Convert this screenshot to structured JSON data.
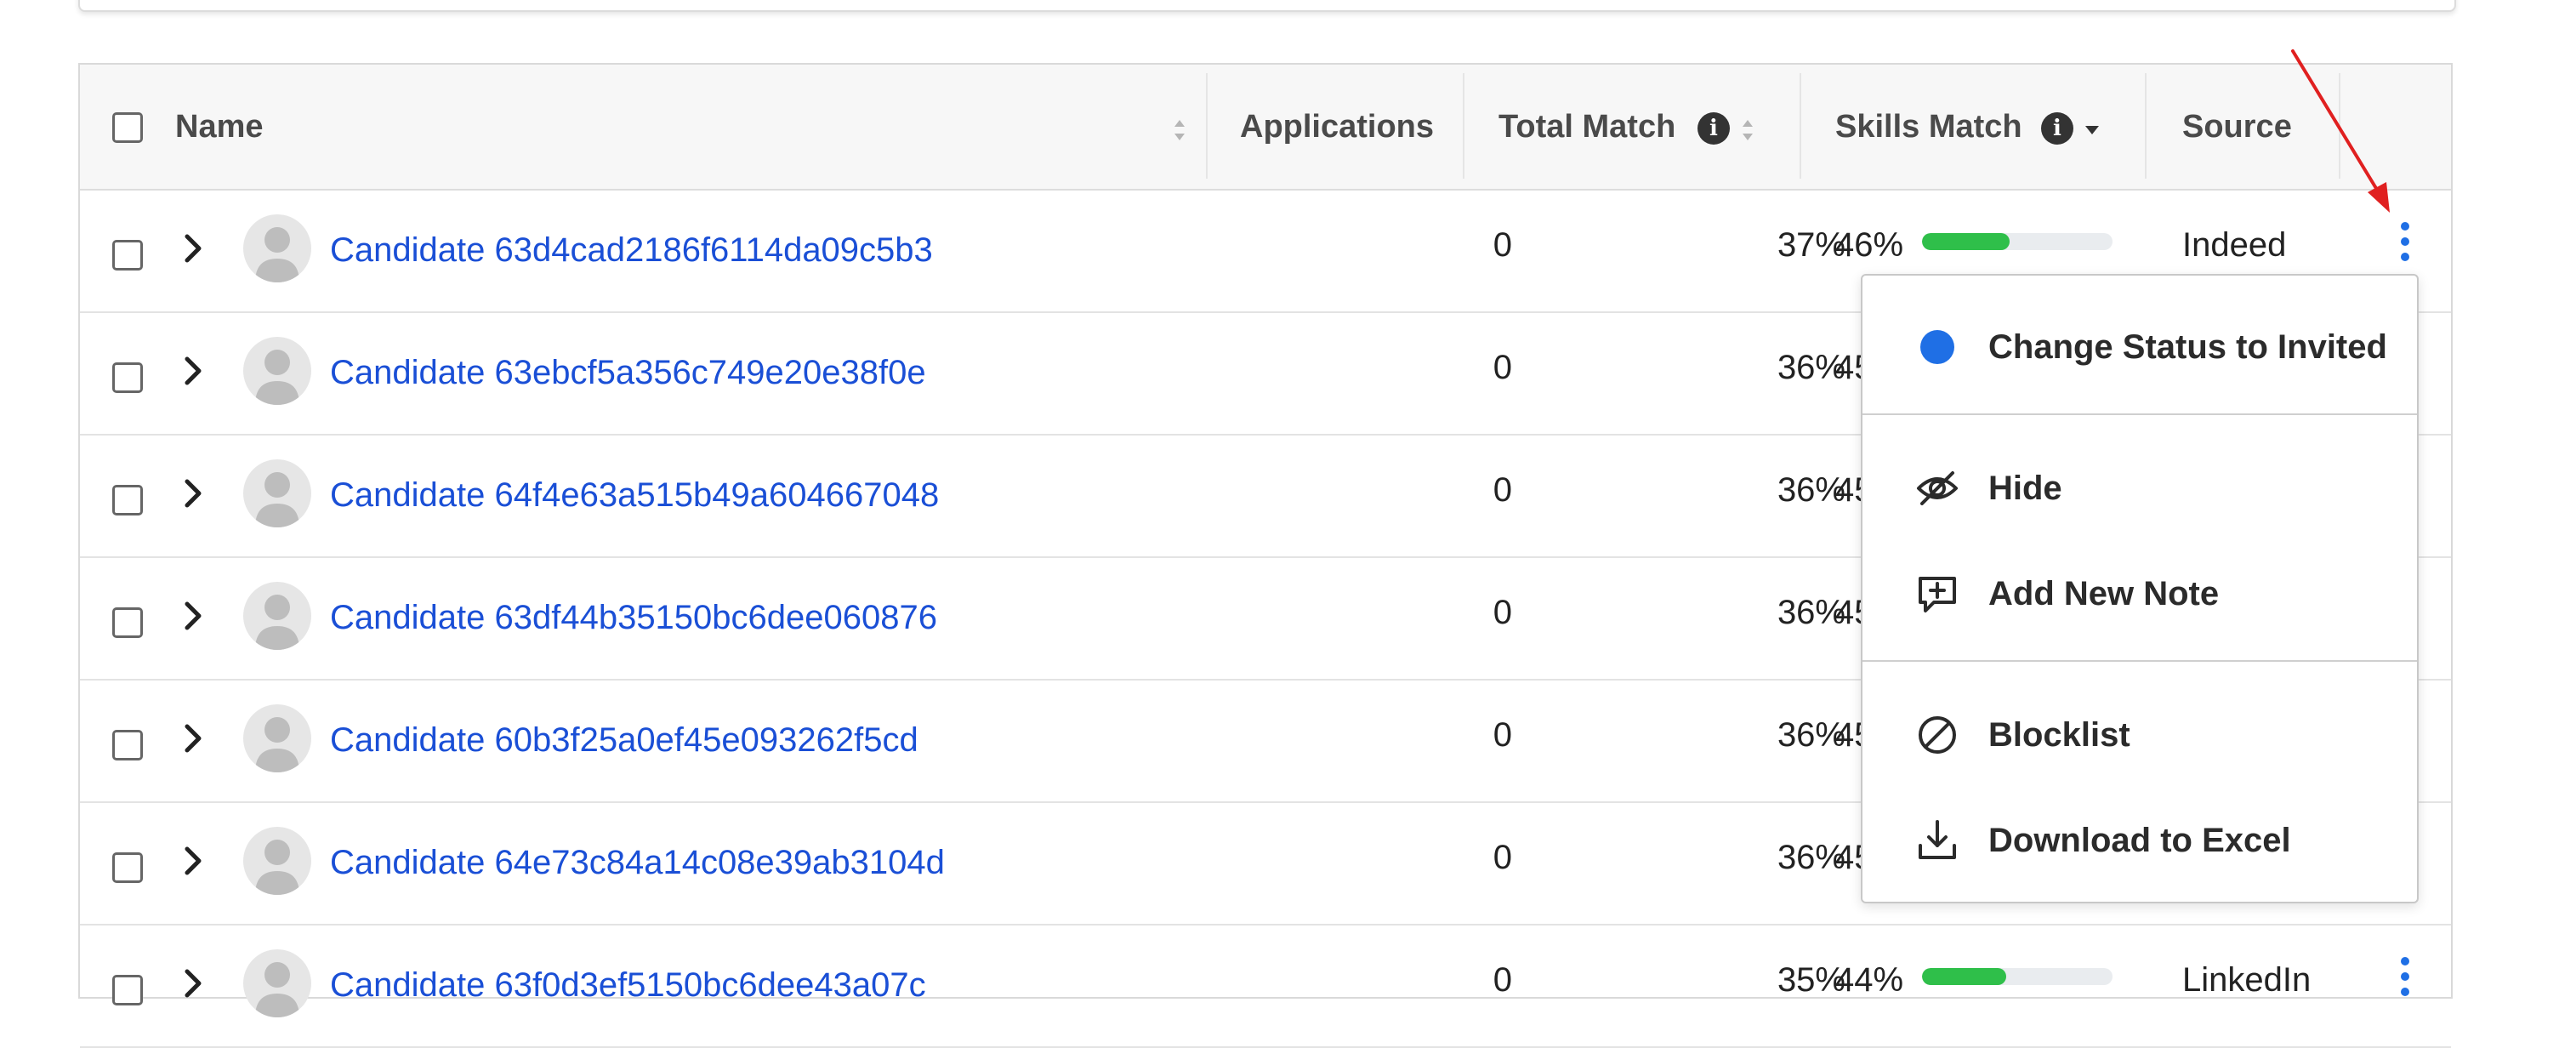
{
  "table": {
    "columns": {
      "name": "Name",
      "applications": "Applications",
      "total_match": "Total Match",
      "skills_match": "Skills Match",
      "source": "Source"
    },
    "rows": [
      {
        "name": "Candidate 63d4cad2186f6114da09c5b3",
        "applications": "0",
        "total_match": "37%",
        "skills_match": "46%",
        "skills_fraction": 0.46,
        "source": "Indeed"
      },
      {
        "name": "Candidate 63ebcf5a356c749e20e38f0e",
        "applications": "0",
        "total_match": "36%",
        "skills_match": "45%",
        "skills_fraction": 0.45,
        "source": ""
      },
      {
        "name": "Candidate 64f4e63a515b49a604667048",
        "applications": "0",
        "total_match": "36%",
        "skills_match": "45%",
        "skills_fraction": 0.45,
        "source": ""
      },
      {
        "name": "Candidate 63df44b35150bc6dee060876",
        "applications": "0",
        "total_match": "36%",
        "skills_match": "45%",
        "skills_fraction": 0.45,
        "source": ""
      },
      {
        "name": "Candidate 60b3f25a0ef45e093262f5cd",
        "applications": "0",
        "total_match": "36%",
        "skills_match": "45%",
        "skills_fraction": 0.45,
        "source": ""
      },
      {
        "name": "Candidate 64e73c84a14c08e39ab3104d",
        "applications": "0",
        "total_match": "36%",
        "skills_match": "45%",
        "skills_fraction": 0.45,
        "source": ""
      },
      {
        "name": "Candidate 63f0d3ef5150bc6dee43a07c",
        "applications": "0",
        "total_match": "35%",
        "skills_match": "44%",
        "skills_fraction": 0.44,
        "source": "LinkedIn"
      }
    ]
  },
  "context_menu": {
    "change_status": "Change Status to Invited",
    "hide": "Hide",
    "add_note": "Add New Note",
    "blocklist": "Blocklist",
    "download": "Download to Excel"
  },
  "colors": {
    "link": "#1a4fd6",
    "accent_blue": "#1f6fe5",
    "progress_green": "#2fbf4a",
    "annotation_red": "#e02020"
  },
  "icons": {
    "row_actions": "kebab-vertical-icon",
    "status_dot": "blue-dot-icon",
    "hide": "eye-slash-icon",
    "note": "message-plus-icon",
    "block": "ban-icon",
    "download": "download-icon"
  }
}
